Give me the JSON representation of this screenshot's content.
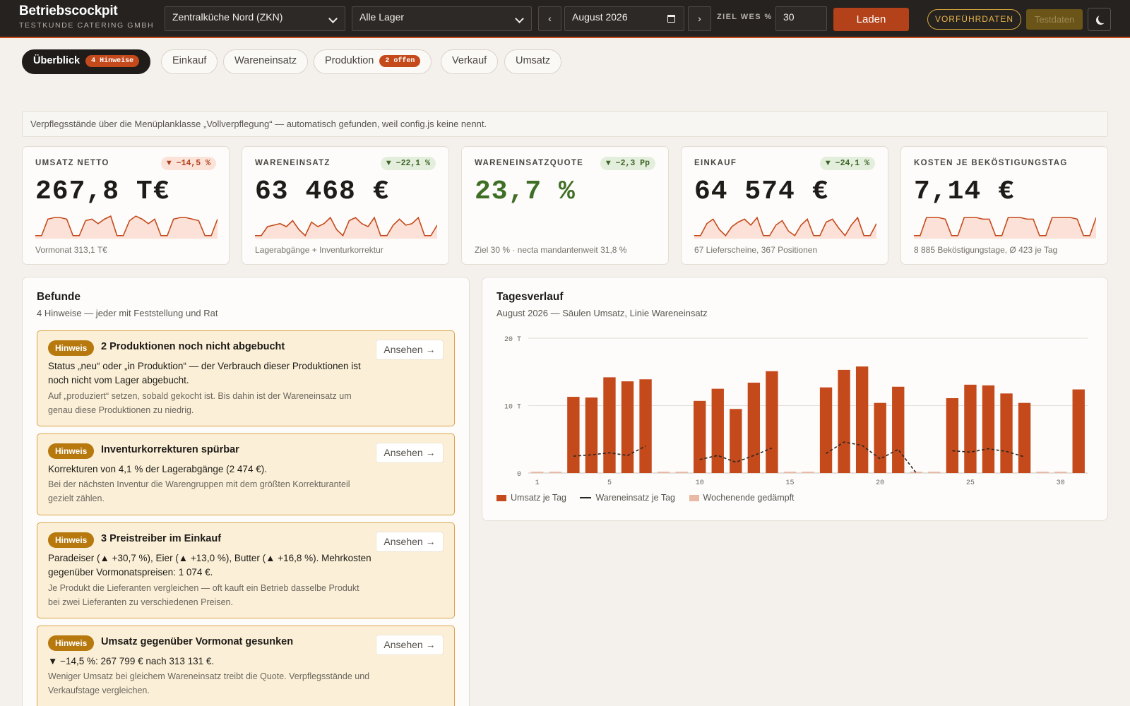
{
  "topbar": {
    "brand_title": "Betriebscockpit",
    "brand_subtitle": "TESTKUNDE CATERING GMBH",
    "kitchen_select": "Zentralküche Nord (ZKN)",
    "lager_select": "Alle Lager",
    "prev_label": "‹",
    "next_label": "›",
    "month_value": "August 2026",
    "ziel_label": "ZIEL WES %",
    "ziel_value": "30",
    "load_label": "Laden",
    "demo_label": "VORFÜHRDATEN",
    "test_label": "Testdaten",
    "theme_icon": "moon-icon"
  },
  "tabs": [
    {
      "label": "Überblick",
      "pill": "4 Hinweise",
      "active": true
    },
    {
      "label": "Einkauf"
    },
    {
      "label": "Wareneinsatz"
    },
    {
      "label": "Produktion",
      "pill": "2 offen"
    },
    {
      "label": "Verkauf"
    },
    {
      "label": "Umsatz"
    }
  ],
  "banner": "Verpflegsstände über die Menüplanklasse „Vollverpflegung“ — automatisch gefunden, weil config.js keine nennt.",
  "kpis": [
    {
      "label": "UMSATZ NETTO",
      "delta": "▼ −14,5 %",
      "delta_tone": "down-red",
      "value": "267,8 T€",
      "footer": "Vormonat 313,1 T€",
      "sparkline": [
        2,
        2,
        13,
        14,
        14,
        13,
        2,
        2,
        12,
        13,
        10,
        13,
        15,
        2,
        2,
        12,
        15,
        13,
        10,
        13,
        2,
        2,
        13,
        14,
        14,
        13,
        12,
        2,
        2,
        13
      ]
    },
    {
      "label": "WARENEINSATZ",
      "delta": "▼ −22,1 %",
      "delta_tone": "down-green",
      "value": "63 468 €",
      "footer": "Lagerabgänge + Inventurkorrektur",
      "sparkline": [
        2,
        2,
        8,
        9,
        10,
        8,
        12,
        6,
        2,
        11,
        8,
        10,
        14,
        6,
        2,
        12,
        14,
        10,
        8,
        14,
        2,
        2,
        9,
        13,
        9,
        10,
        14,
        2,
        2,
        9
      ]
    },
    {
      "label": "WARENEINSATZQUOTE",
      "delta": "▼ −2,3 Pp",
      "delta_tone": "down-green",
      "value": "23,7 %",
      "value_tone": "green",
      "footer": "Ziel 30 % · necta mandantenweit 31,8 %"
    },
    {
      "label": "EINKAUF",
      "delta": "▼ −24,1 %",
      "delta_tone": "down-green",
      "value": "64 574 €",
      "footer": "67 Lieferscheine, 367 Positionen",
      "sparkline": [
        2,
        2,
        10,
        13,
        6,
        2,
        8,
        11,
        13,
        9,
        14,
        2,
        2,
        9,
        12,
        5,
        2,
        9,
        13,
        2,
        2,
        11,
        13,
        7,
        2,
        9,
        14,
        2,
        2,
        10
      ]
    },
    {
      "label": "KOSTEN JE BEKÖSTIGUNGSTAG",
      "delta": "",
      "value": "7,14 €",
      "footer": "8 885 Beköstigungstage, Ø 423 je Tag",
      "sparkline": [
        2,
        2,
        14,
        14,
        14,
        13,
        2,
        2,
        14,
        14,
        14,
        13,
        13,
        2,
        2,
        14,
        14,
        14,
        13,
        13,
        2,
        2,
        14,
        14,
        14,
        14,
        13,
        2,
        2,
        14
      ]
    }
  ],
  "findings_panel": {
    "title": "Befunde",
    "subtitle": "4 Hinweise — jeder mit Feststellung und Rat"
  },
  "findings": [
    {
      "badge": "Hinweis",
      "title": "2 Produktionen noch nicht abgebucht",
      "main": "Status „neu“ oder „in Produktion“ — der Verbrauch dieser Produktionen ist noch nicht vom Lager abgebucht.",
      "hint": "Auf „produziert“ setzen, sobald gekocht ist. Bis dahin ist der Wareneinsatz um genau diese Produktionen zu niedrig.",
      "action": "Ansehen →"
    },
    {
      "badge": "Hinweis",
      "title": "Inventurkorrekturen spürbar",
      "main": "Korrekturen von 4,1 % der Lagerabgänge (2 474 €).",
      "hint": "Bei der nächsten Inventur die Warengruppen mit dem größten Korrekturanteil gezielt zählen.",
      "action": "Ansehen →"
    },
    {
      "badge": "Hinweis",
      "title": "3 Preistreiber im Einkauf",
      "main": "Paradeiser (▲ +30,7 %), Eier (▲ +13,0 %), Butter (▲ +16,8 %). Mehrkosten gegenüber Vormonatspreisen: 1 074 €.",
      "hint": "Je Produkt die Lieferanten vergleichen — oft kauft ein Betrieb dasselbe Produkt bei zwei Lieferanten zu verschiedenen Preisen.",
      "action": "Ansehen →"
    },
    {
      "badge": "Hinweis",
      "title": "Umsatz gegenüber Vormonat gesunken",
      "main": "▼ −14,5 %: 267 799 € nach 313 131 €.",
      "hint": "Weniger Umsatz bei gleichem Wareneinsatz treibt die Quote. Verpflegsstände und Verkaufstage vergleichen.",
      "action": "Ansehen →"
    }
  ],
  "chart_panel": {
    "title": "Tagesverlauf",
    "subtitle": "August 2026 — Säulen Umsatz, Linie Wareneinsatz"
  },
  "chart_data": {
    "type": "bar",
    "x": [
      1,
      2,
      3,
      4,
      5,
      6,
      7,
      8,
      9,
      10,
      11,
      12,
      13,
      14,
      15,
      16,
      17,
      18,
      19,
      20,
      21,
      22,
      23,
      24,
      25,
      26,
      27,
      28,
      29,
      30,
      31
    ],
    "x_ticks": [
      1,
      5,
      10,
      15,
      20,
      25,
      30
    ],
    "y_ticks": [
      0,
      10,
      20
    ],
    "y_tick_labels": [
      "0",
      "10 T",
      "20 T"
    ],
    "ylim": [
      0,
      20
    ],
    "series": [
      {
        "name": "Umsatz je Tag",
        "kind": "bar",
        "color": "#c44a1c",
        "values": [
          0.2,
          0.2,
          11.3,
          11.2,
          14.2,
          13.6,
          13.9,
          0.2,
          0.2,
          10.7,
          12.5,
          9.5,
          13.4,
          15.1,
          0.2,
          0.2,
          12.7,
          15.3,
          15.8,
          10.4,
          12.8,
          0.2,
          0.2,
          11.1,
          13.1,
          13.0,
          11.8,
          10.4,
          0.2,
          0.2,
          12.4
        ]
      },
      {
        "name": "Wareneinsatz je Tag",
        "kind": "line",
        "color": "#2a2623",
        "values": [
          null,
          null,
          2.5,
          2.7,
          3.0,
          2.6,
          4.0,
          null,
          null,
          2.0,
          2.6,
          1.6,
          2.6,
          3.7,
          null,
          null,
          2.9,
          4.6,
          4.1,
          2.1,
          3.5,
          0,
          null,
          3.3,
          3.1,
          3.6,
          3.2,
          2.4,
          null,
          null,
          null
        ]
      }
    ],
    "weekend_days": [
      1,
      2,
      8,
      9,
      15,
      16,
      22,
      23,
      29,
      30
    ],
    "weekend_color": "#e9b9a3",
    "legend": [
      "Umsatz je Tag",
      "Wareneinsatz je Tag",
      "Wochenende gedämpft"
    ]
  }
}
